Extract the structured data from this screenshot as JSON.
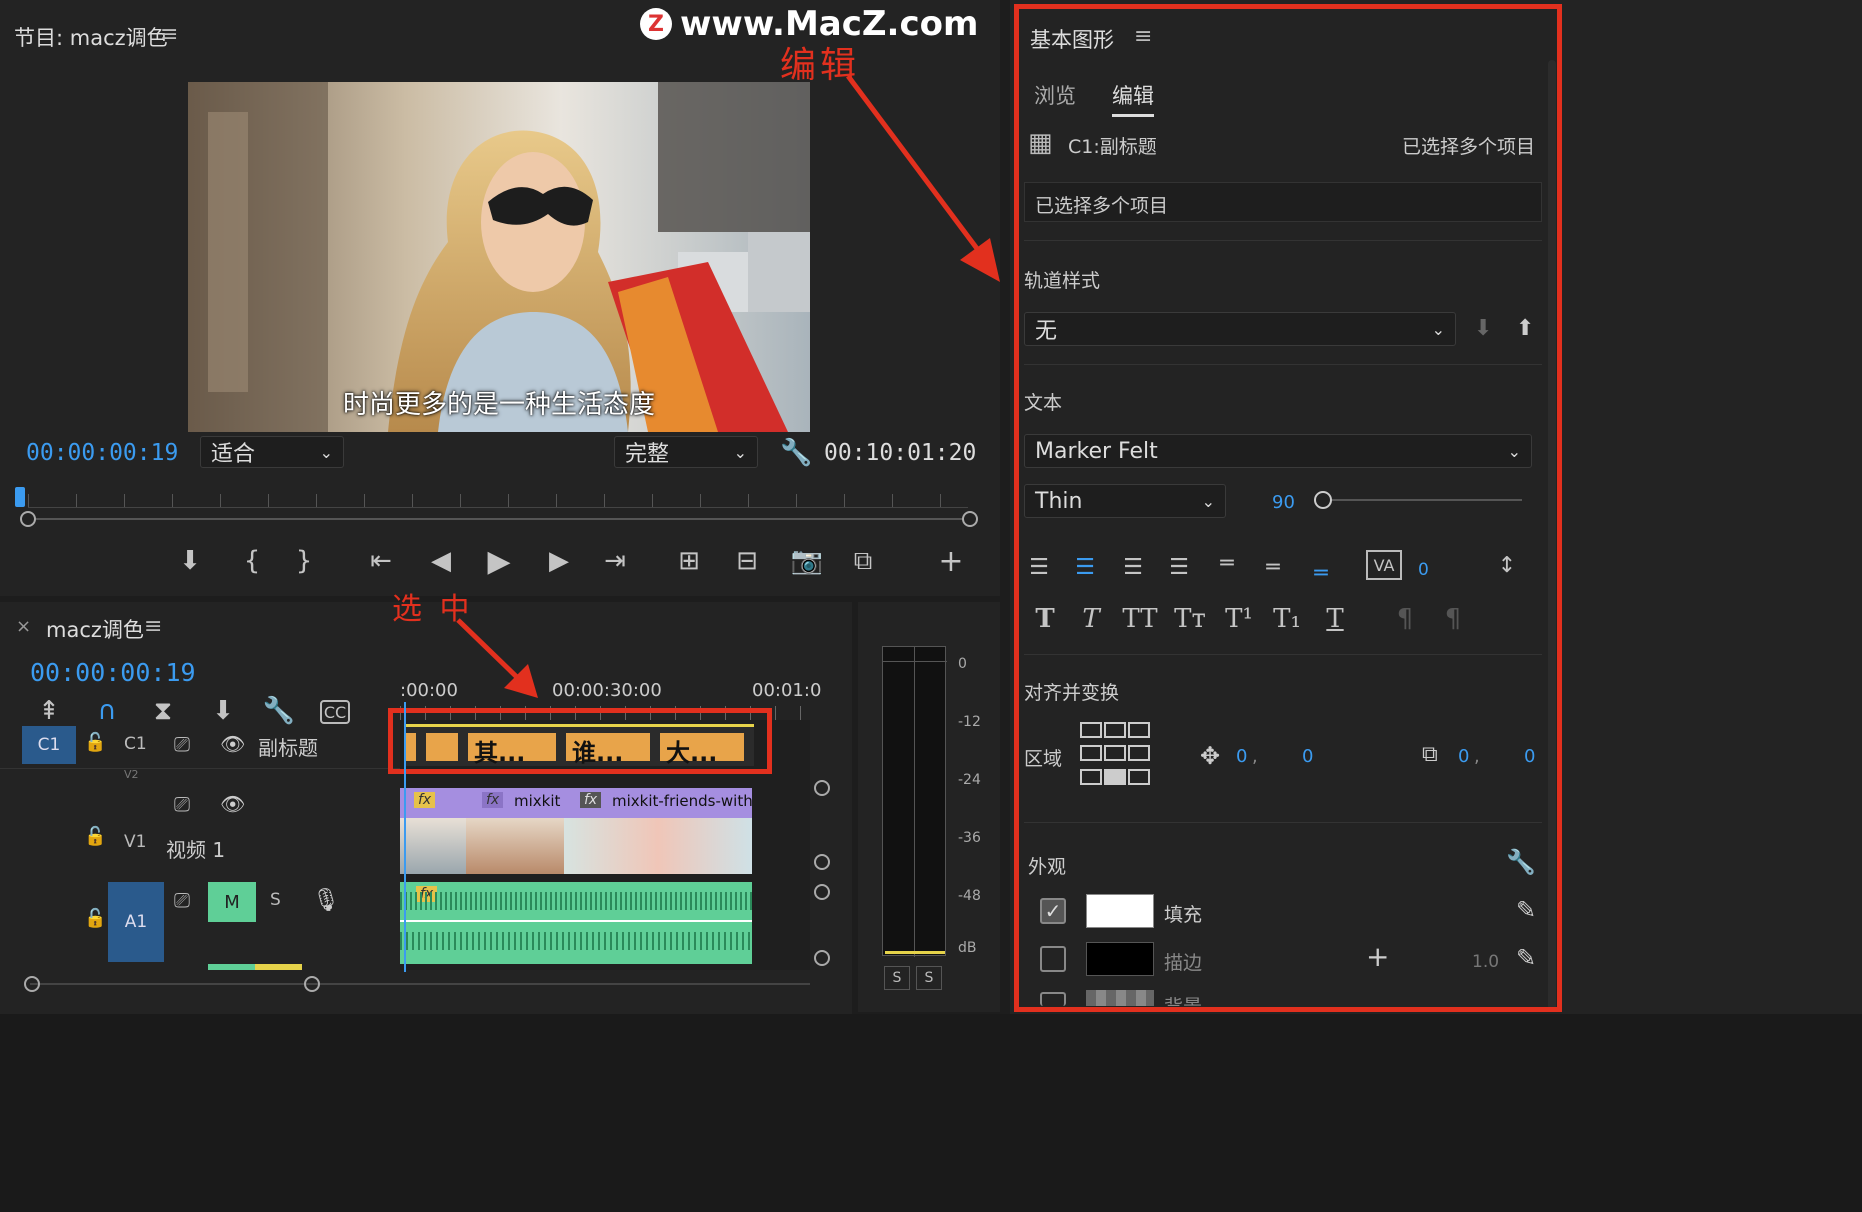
{
  "watermark": {
    "site": "www.MacZ.com",
    "logo_letter": "Z"
  },
  "annotations": {
    "edit": "编辑",
    "select": "选 中"
  },
  "program_monitor": {
    "title": "节目: macz调色",
    "subtitle_text": "时尚更多的是一种生活态度",
    "timecode_current": "00:00:00:19",
    "fit_select": "适合",
    "quality_select": "完整",
    "timecode_duration": "00:10:01:20"
  },
  "timeline": {
    "sequence_name": "macz调色",
    "timecode": "00:00:00:19",
    "ruler": [
      ":00:00",
      "00:00:30:00",
      "00:01:0"
    ],
    "tracks": {
      "c1": {
        "target": "C1",
        "name": "C1",
        "label": "副标题"
      },
      "v2": {
        "name": "V2"
      },
      "v1": {
        "name": "V1",
        "label": "视频 1"
      },
      "a1": {
        "target": "A1",
        "mute": "M",
        "solo": "S"
      }
    },
    "caption_clips": [
      "其...",
      "谁...",
      "大..."
    ],
    "video_clips": [
      "mixkit",
      "mixkit-friends-with-"
    ],
    "fx_badge": "fx"
  },
  "meter": {
    "scale": [
      "0",
      "-12",
      "-24",
      "-36",
      "-48",
      "dB"
    ],
    "solo_buttons": [
      "S",
      "S"
    ]
  },
  "essential_graphics": {
    "title": "基本图形",
    "tabs": [
      "浏览",
      "编辑"
    ],
    "active_tab": "编辑",
    "clip_name": "C1:副标题",
    "selection_status": "已选择多个项目",
    "text_field": "已选择多个项目",
    "track_style_label": "轨道样式",
    "track_style_value": "无",
    "text_section": "文本",
    "font": "Marker Felt",
    "font_style": "Thin",
    "font_size": "90",
    "tracking_value": "0",
    "align_section": "对齐并变换",
    "region_label": "区域",
    "position": [
      "0",
      "0"
    ],
    "anchor": [
      "0",
      "0"
    ],
    "appearance_section": "外观",
    "fill_label": "填充",
    "stroke_label": "描边",
    "stroke_width": "1.0",
    "background_label": "背景"
  },
  "colors": {
    "accent": "#3b9bf0",
    "annotation": "#e2301e",
    "clip_caption": "#e8a44a",
    "clip_video": "#a58ee0",
    "clip_audio": "#5fcf97"
  }
}
